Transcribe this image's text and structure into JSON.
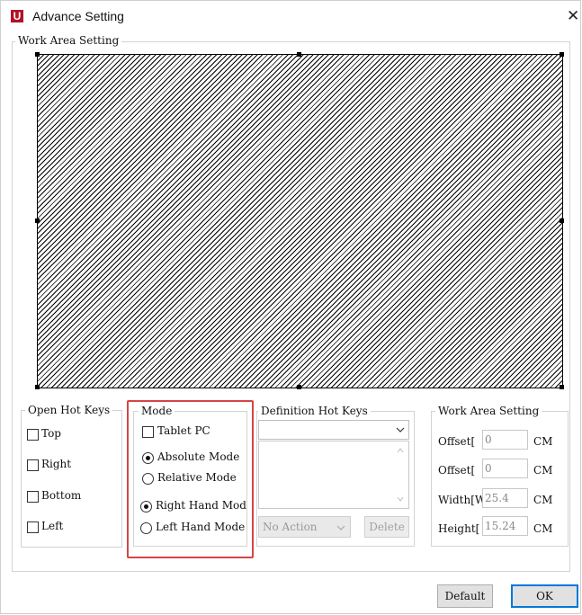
{
  "window": {
    "title": "Advance Setting",
    "app_icon_letter": "U",
    "close_glyph": "✕"
  },
  "work_area_group": {
    "label": "Work Area Setting"
  },
  "open_hot_keys": {
    "label": "Open Hot Keys",
    "options": [
      "Top",
      "Right",
      "Bottom",
      "Left"
    ]
  },
  "mode": {
    "label": "Mode",
    "tablet_pc": "Tablet PC",
    "absolute": "Absolute Mode",
    "relative": "Relative Mode",
    "right_hand": "Right Hand Mod",
    "left_hand": "Left Hand Mode",
    "selected_mode": "absolute",
    "selected_hand": "right_hand"
  },
  "definition_hot_keys": {
    "label": "Definition Hot Keys",
    "combo_value": "",
    "action_value": "No Action",
    "delete_label": "Delete"
  },
  "work_area_setting": {
    "label": "Work Area Setting",
    "offset1_label": "Offset[",
    "offset1_value": "0",
    "offset2_label": "Offset[",
    "offset2_value": "0",
    "width_label": "Width[W",
    "width_value": "25.4",
    "height_label": "Height[",
    "height_value": "15.24",
    "unit": "CM"
  },
  "buttons": {
    "default": "Default",
    "ok": "OK"
  }
}
